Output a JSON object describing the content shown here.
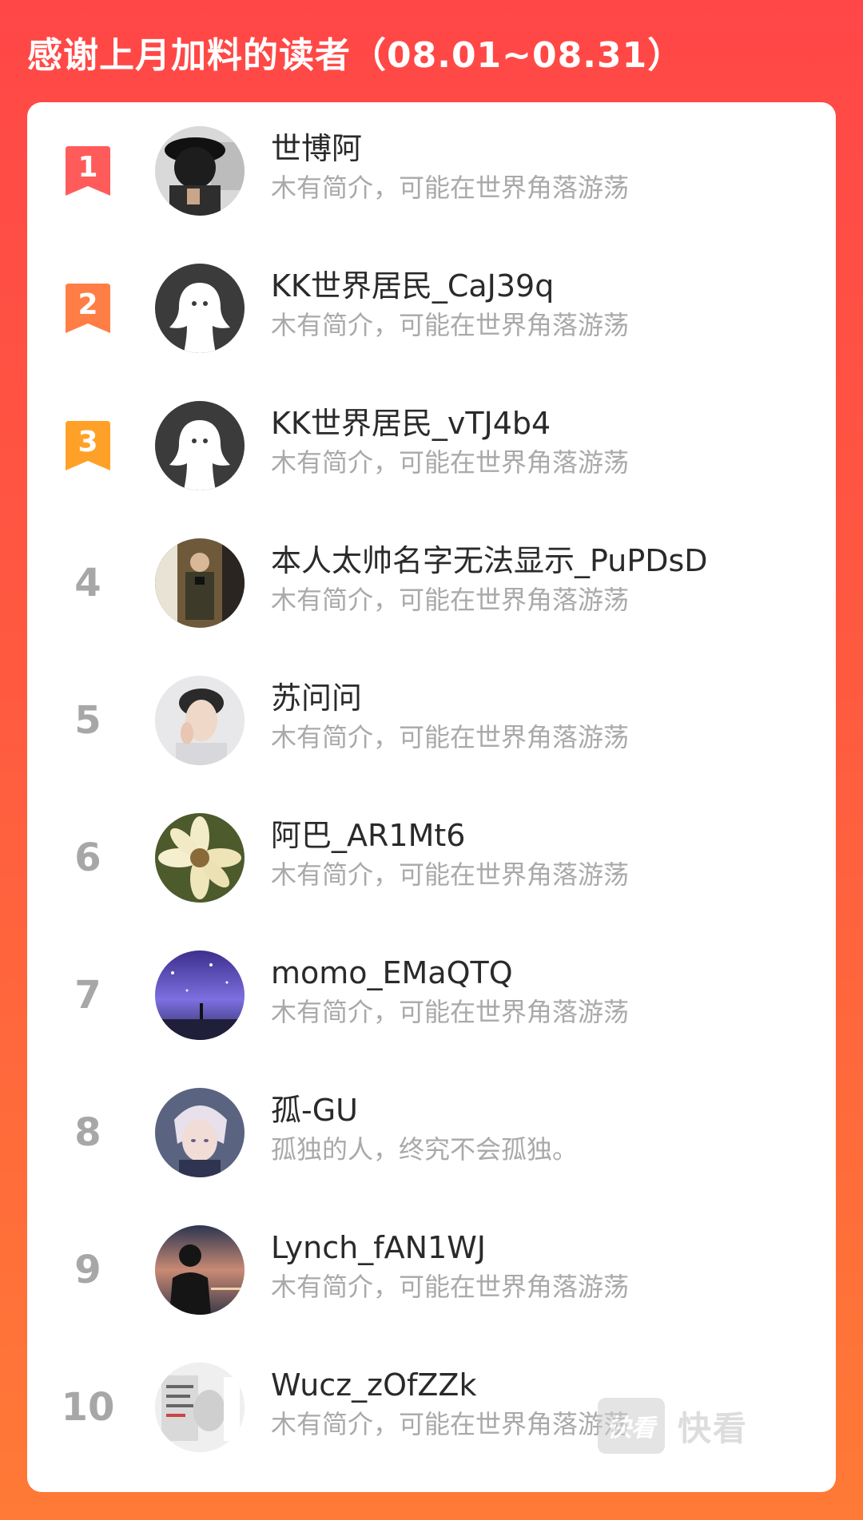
{
  "header": {
    "title": "感谢上月加料的读者（08.01~08.31）"
  },
  "colors": {
    "background_top": "#ff4747",
    "background_bottom": "#ff7a36",
    "rank1_badge": "#ff5b5b",
    "rank2_badge": "#ff7e45",
    "rank3_badge": "#ffa128",
    "rank_plain": "#a7a7a7",
    "name_text": "#2a2a2a",
    "bio_text": "#a9a9a9"
  },
  "readers": [
    {
      "rank": "1",
      "name": "世博阿",
      "bio": "木有简介，可能在世界角落游荡",
      "avatar": "photo-black-hat-avatar"
    },
    {
      "rank": "2",
      "name": "KK世界居民_CaJ39q",
      "bio": "木有简介，可能在世界角落游荡",
      "avatar": "default-ghost-avatar"
    },
    {
      "rank": "3",
      "name": "KK世界居民_vTJ4b4",
      "bio": "木有简介，可能在世界角落游荡",
      "avatar": "default-ghost-avatar"
    },
    {
      "rank": "4",
      "name": "本人太帅名字无法显示_PuPDsD",
      "bio": "木有简介，可能在世界角落游荡",
      "avatar": "photo-mirror-selfie-avatar"
    },
    {
      "rank": "5",
      "name": "苏问问",
      "bio": "木有简介，可能在世界角落游荡",
      "avatar": "photo-portrait-avatar"
    },
    {
      "rank": "6",
      "name": "阿巴_AR1Mt6",
      "bio": "木有简介，可能在世界角落游荡",
      "avatar": "photo-flower-avatar"
    },
    {
      "rank": "7",
      "name": "momo_EMaQTQ",
      "bio": "木有简介，可能在世界角落游荡",
      "avatar": "illustration-night-sky-avatar"
    },
    {
      "rank": "8",
      "name": "孤-GU",
      "bio": "孤独的人，终究不会孤独。",
      "avatar": "anime-character-avatar"
    },
    {
      "rank": "9",
      "name": "Lynch_fAN1WJ",
      "bio": "木有简介，可能在世界角落游荡",
      "avatar": "photo-silhouette-sunset-avatar"
    },
    {
      "rank": "10",
      "name": "Wucz_zOfZZk",
      "bio": "木有简介，可能在世界角落游荡",
      "avatar": "meme-sticker-avatar"
    }
  ],
  "watermark": {
    "logo_text": "快看",
    "label": "快看"
  }
}
